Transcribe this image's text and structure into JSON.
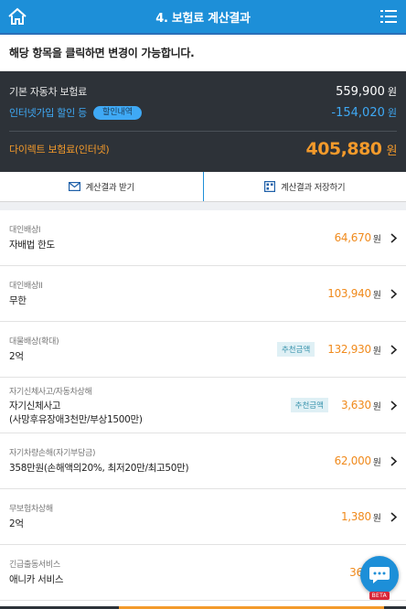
{
  "header": {
    "title": "4. 보험료 계산결과",
    "home_icon": "home-icon",
    "menu_icon": "hamburger-menu-icon"
  },
  "notice": "해당 항목을 클릭하면 변경이 가능합니다.",
  "summary": {
    "base_label": "기본 자동차 보험료",
    "base_value": "559,900",
    "base_unit": "원",
    "discount_label": "인터넷가입 할인 등",
    "discount_badge": "할인내역",
    "discount_value": "-154,020",
    "discount_unit": "원",
    "direct_label": "다이렉트 보험료(인터넷)",
    "direct_value": "405,880",
    "direct_unit": "원"
  },
  "actions": {
    "receive": "계산결과 받기",
    "save": "계산결과 저장하기"
  },
  "items": [
    {
      "category": "대인배상I",
      "value": "자배법 한도",
      "badge": "",
      "price": "64,670",
      "unit": "원"
    },
    {
      "category": "대인배상II",
      "value": "무한",
      "badge": "",
      "price": "103,940",
      "unit": "원"
    },
    {
      "category": "대물배상(확대)",
      "value": "2억",
      "badge": "추천금액",
      "price": "132,930",
      "unit": "원"
    },
    {
      "category": "자기신체사고/자동차상해",
      "value": "자기신체사고",
      "value2": "(사망후유장애3천만/부상1500만)",
      "badge": "추천금액",
      "price": "3,630",
      "unit": "원"
    },
    {
      "category": "자기차량손해(자기부담금)",
      "value": "358만원(손해액의20%, 최저20만/최고50만)",
      "badge": "",
      "price": "62,000",
      "unit": "원"
    },
    {
      "category": "무보험차상해",
      "value": "2억",
      "badge": "",
      "price": "1,380",
      "unit": "원"
    },
    {
      "category": "긴급출동서비스",
      "value": "애니카 서비스",
      "badge": "",
      "price": "36,26",
      "unit": ""
    }
  ],
  "chat": {
    "icon": "chat-bubble-icon",
    "badge": "BETA"
  },
  "colors": {
    "primary": "#1d8fd8",
    "accent": "#f39a2b",
    "dark": "#2d3238",
    "discount": "#3fa9f5"
  }
}
